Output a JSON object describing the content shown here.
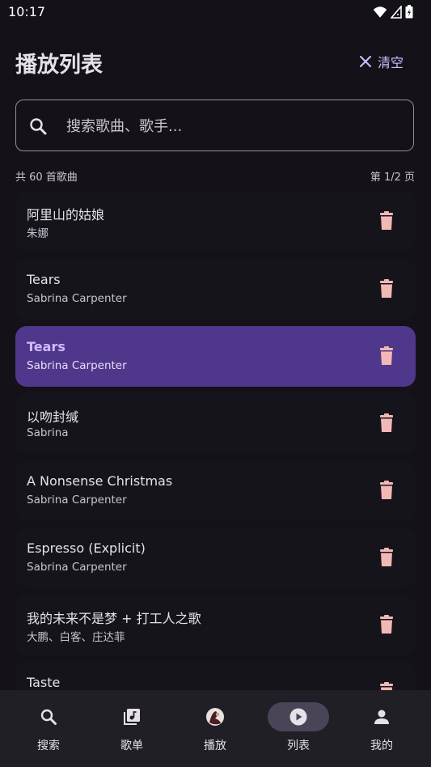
{
  "status": {
    "time": "10:17"
  },
  "header": {
    "title": "播放列表",
    "clear_label": "清空"
  },
  "search": {
    "placeholder": "搜索歌曲、歌手..."
  },
  "summary": {
    "count_text": "共 60 首歌曲",
    "page_text": "第 1/2 页"
  },
  "songs": [
    {
      "title": "阿里山的姑娘",
      "artist": "朱娜",
      "active": false
    },
    {
      "title": "Tears",
      "artist": "Sabrina Carpenter",
      "active": false
    },
    {
      "title": "Tears",
      "artist": "Sabrina Carpenter",
      "active": true
    },
    {
      "title": "以吻封缄",
      "artist": "Sabrina",
      "active": false
    },
    {
      "title": "A Nonsense Christmas",
      "artist": "Sabrina Carpenter",
      "active": false
    },
    {
      "title": "Espresso (Explicit)",
      "artist": "Sabrina Carpenter",
      "active": false
    },
    {
      "title": "我的未来不是梦 + 打工人之歌",
      "artist": "大鹏、白客、庄达菲",
      "active": false
    },
    {
      "title": "Taste",
      "artist": "",
      "active": false
    }
  ],
  "nav": {
    "items": [
      {
        "label": "搜索",
        "icon": "search-icon",
        "active": false
      },
      {
        "label": "歌单",
        "icon": "playlist-icon",
        "active": false
      },
      {
        "label": "播放",
        "icon": "album-cover-icon",
        "active": false
      },
      {
        "label": "列表",
        "icon": "play-circle-icon",
        "active": true
      },
      {
        "label": "我的",
        "icon": "person-icon",
        "active": false
      }
    ]
  },
  "colors": {
    "background": "#141218",
    "accent": "#CFBCFF",
    "active_row": "#4F378B",
    "delete_icon": "#F2B8B5",
    "nav_bar": "#211F26"
  }
}
